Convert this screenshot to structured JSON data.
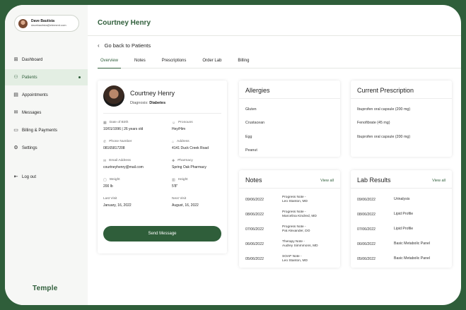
{
  "user": {
    "name": "Dave Bautista",
    "email": "davebautista@element.com"
  },
  "sidebar": {
    "items": [
      {
        "label": "Dashboard",
        "icon": "grid-icon"
      },
      {
        "label": "Patients",
        "icon": "users-icon",
        "active": true
      },
      {
        "label": "Appointments",
        "icon": "calendar-icon"
      },
      {
        "label": "Messages",
        "icon": "mail-icon"
      },
      {
        "label": "Billing & Payments",
        "icon": "card-icon"
      },
      {
        "label": "Settings",
        "icon": "gear-icon"
      }
    ],
    "logout": "Log out",
    "brand": "Temple"
  },
  "header": {
    "title": "Courtney Henry"
  },
  "back_link": "Go back to Patients",
  "tabs": [
    "Overview",
    "Notes",
    "Prescriptions",
    "Order Lab",
    "Billing"
  ],
  "profile": {
    "name": "Courtney Henry",
    "diagnosis_label": "Diagnosis:",
    "diagnosis": "Diabetes",
    "fields": [
      {
        "label": "Date of Birth",
        "value": "10/01/1996 | 26 years old"
      },
      {
        "label": "Pronouns",
        "value": "Hey/Him"
      },
      {
        "label": "Phone Number",
        "value": "08165817208"
      },
      {
        "label": "Address",
        "value": "4141 Duck Creek Road"
      },
      {
        "label": "Email Address",
        "value": "courtneyhenry@mail.com"
      },
      {
        "label": "Pharmacy",
        "value": "Spring Oak Pharmacy"
      },
      {
        "label": "Weight",
        "value": "200 lb"
      },
      {
        "label": "Height",
        "value": "5'8\""
      },
      {
        "label": "Last Visit",
        "value": "January, 16, 2022"
      },
      {
        "label": "Next Visit",
        "value": "August, 16, 2022"
      }
    ],
    "send_button": "Send Message"
  },
  "allergies": {
    "title": "Allergies",
    "items": [
      "Gluten",
      "Crustacean",
      "Egg",
      "Peanut"
    ]
  },
  "prescription": {
    "title": "Current Prescription",
    "items": [
      "Ibuprofen oral capsule (200 mg)",
      "Fenofibrate (45 mg)",
      "Ibuprofen oral capsule (200 mg)"
    ]
  },
  "notes": {
    "title": "Notes",
    "view_all": "View all",
    "rows": [
      {
        "date": "09/06/2022",
        "line1": "Progress Note -",
        "line2": "Leo Stanton, MD"
      },
      {
        "date": "08/06/2022",
        "line1": "Progress Note -",
        "line2": "Marcelina Kindred, MD"
      },
      {
        "date": "07/06/2022",
        "line1": "Progress Note -",
        "line2": "Pat Alexander, DO"
      },
      {
        "date": "06/06/2022",
        "line1": "Therapy Note -",
        "line2": "Audrey Simmmons, MD"
      },
      {
        "date": "05/06/2022",
        "line1": "SOAP Note -",
        "line2": "Leo Stanton, MD"
      }
    ]
  },
  "labs": {
    "title": "Lab Results",
    "view_all": "View all",
    "rows": [
      {
        "date": "09/06/2022",
        "test": "Urinalysis"
      },
      {
        "date": "08/06/2022",
        "test": "Lipid Profile"
      },
      {
        "date": "07/06/2022",
        "test": "Lipid Profile"
      },
      {
        "date": "06/06/2022",
        "test": "Basic Metabolic Panel"
      },
      {
        "date": "05/06/2022",
        "test": "Basic Metabolic Panel"
      }
    ]
  }
}
